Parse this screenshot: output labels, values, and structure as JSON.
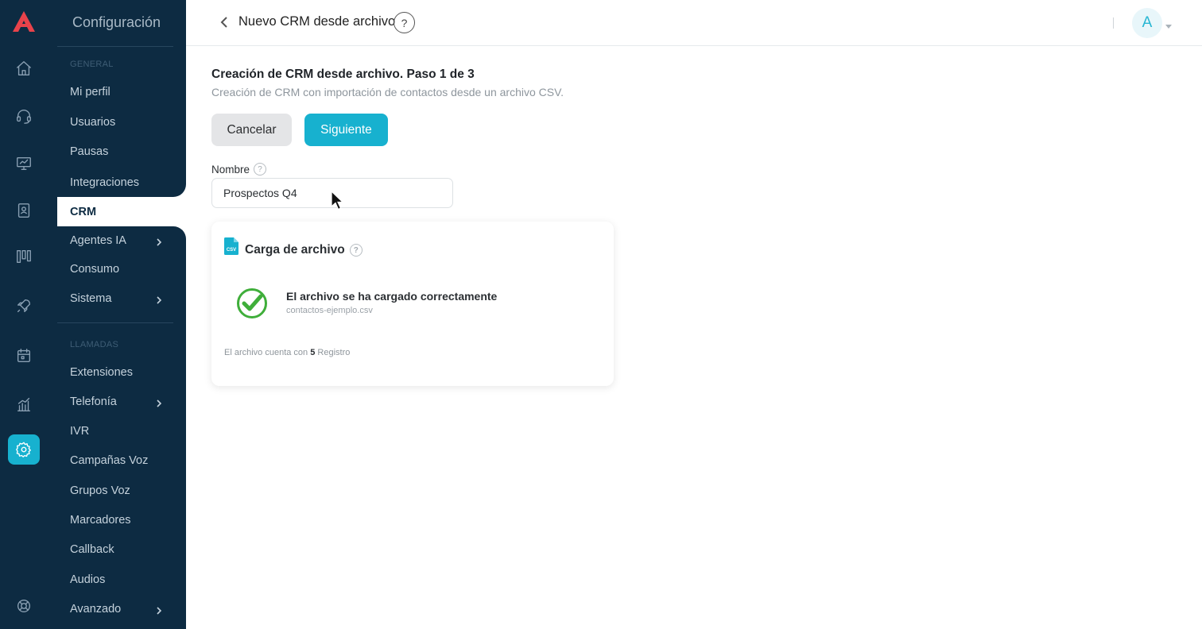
{
  "app": {
    "brand_color": "#e8434b",
    "accent": "#17b1cf",
    "sidebar_bg": "#0d2b42"
  },
  "rail": {
    "items": [
      {
        "icon": "home-icon"
      },
      {
        "icon": "headset-icon"
      },
      {
        "icon": "monitor-icon"
      },
      {
        "icon": "contacts-book-icon"
      },
      {
        "icon": "kanban-icon"
      },
      {
        "icon": "rocket-icon"
      },
      {
        "icon": "calendar-icon"
      },
      {
        "icon": "bar-chart-icon"
      },
      {
        "icon": "settings-gear-icon",
        "active": true
      },
      {
        "icon": "lifebuoy-icon"
      }
    ]
  },
  "sidebar": {
    "title": "Configuración",
    "section_general": "GENERAL",
    "general_items": [
      {
        "label": "Mi perfil"
      },
      {
        "label": "Usuarios"
      },
      {
        "label": "Pausas"
      },
      {
        "label": "Integraciones"
      },
      {
        "label": "CRM",
        "active": true
      },
      {
        "label": "Agentes IA",
        "has_submenu": true
      },
      {
        "label": "Consumo"
      },
      {
        "label": "Sistema",
        "has_submenu": true
      }
    ],
    "section_calls": "LLAMADAS",
    "call_items": [
      {
        "label": "Extensiones"
      },
      {
        "label": "Telefonía",
        "has_submenu": true
      },
      {
        "label": "IVR"
      },
      {
        "label": "Campañas Voz"
      },
      {
        "label": "Grupos Voz"
      },
      {
        "label": "Marcadores"
      },
      {
        "label": "Callback"
      },
      {
        "label": "Audios"
      },
      {
        "label": "Avanzado",
        "has_submenu": true
      }
    ]
  },
  "header": {
    "title": "Nuevo CRM desde archivo",
    "help": "?",
    "avatar_initial": "A"
  },
  "main": {
    "title": "Creación de CRM desde archivo. Paso 1 de 3",
    "subtitle": "Creación de CRM con importación de contactos desde un archivo CSV.",
    "cancel_label": "Cancelar",
    "next_label": "Siguiente",
    "name_label": "Nombre",
    "name_help": "?",
    "name_value": "Prospectos Q4",
    "card": {
      "title": "Carga de archivo",
      "help": "?",
      "file_badge": "CSV",
      "success_message": "El archivo se ha cargado correctamente",
      "file_name": "contactos-ejemplo.csv",
      "records_prefix": "El archivo cuenta con",
      "records_count": "5",
      "records_suffix": "Registro"
    }
  }
}
